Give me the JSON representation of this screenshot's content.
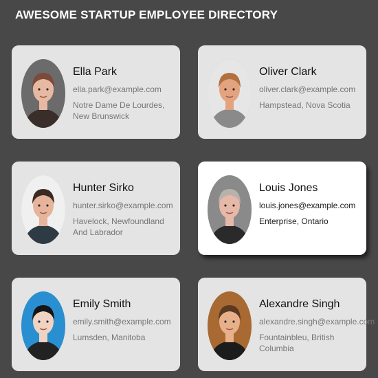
{
  "header": {
    "title": "AWESOME STARTUP EMPLOYEE DIRECTORY"
  },
  "employees": [
    {
      "name": "Ella Park",
      "email": "ella.park@example.com",
      "location": "Notre Dame De Lourdes, New Brunswick",
      "photo": "woman-photo-1",
      "hair": "#7b4a3a",
      "skin": "#e8b9a2",
      "bg": "#6b6b6b",
      "shirt": "#3a2e2a"
    },
    {
      "name": "Oliver Clark",
      "email": "oliver.clark@example.com",
      "location": "Hampstead, Nova Scotia",
      "photo": "man-photo-1",
      "hair": "#b07040",
      "skin": "#e2a37e",
      "bg": "#e6e6e6",
      "shirt": "#8a8a8a"
    },
    {
      "name": "Hunter Sirko",
      "email": "hunter.sirko@example.com",
      "location": "Havelock, Newfoundland And Labrador",
      "photo": "man-photo-2",
      "hair": "#3a2a22",
      "skin": "#e5b49a",
      "bg": "#f0f0f0",
      "shirt": "#2e3a44"
    },
    {
      "name": "Louis Jones",
      "email": "louis.jones@example.com",
      "location": "Enterprise, Ontario",
      "photo": "man-photo-3",
      "hair": "#b8b2ac",
      "skin": "#e6b8a8",
      "bg": "#8a8a8a",
      "shirt": "#2a2a2a"
    },
    {
      "name": "Emily Smith",
      "email": "emily.smith@example.com",
      "location": "Lumsden, Manitoba",
      "photo": "woman-photo-2",
      "hair": "#151515",
      "skin": "#f0d3c2",
      "bg": "#2a8fd0",
      "shirt": "#222222"
    },
    {
      "name": "Alexandre Singh",
      "email": "alexandre.singh@example.com",
      "location": "Fountainbleu, British Columbia",
      "photo": "man-photo-4",
      "hair": "#5a3a22",
      "skin": "#e8b08a",
      "bg": "#a86a32",
      "shirt": "#1c1c1c"
    }
  ],
  "selected_index": 3
}
